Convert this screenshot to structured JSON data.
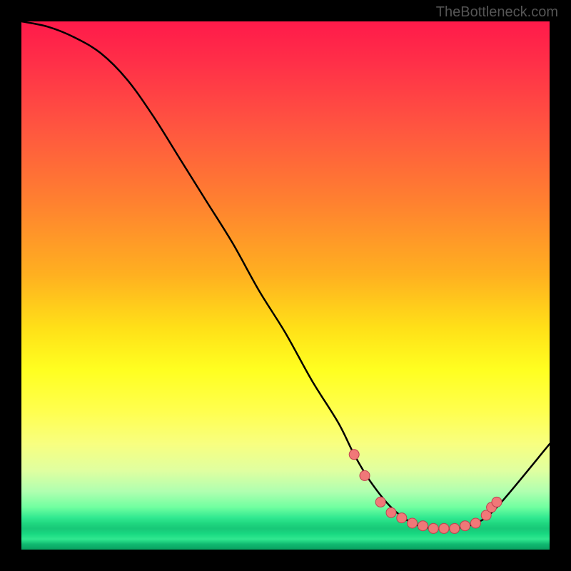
{
  "watermark": "TheBottleneck.com",
  "chart_data": {
    "type": "line",
    "title": "",
    "xlabel": "",
    "ylabel": "",
    "xlim": [
      0,
      100
    ],
    "ylim": [
      0,
      100
    ],
    "series": [
      {
        "name": "curve",
        "x": [
          0,
          5,
          10,
          15,
          20,
          25,
          30,
          35,
          40,
          45,
          50,
          55,
          60,
          63,
          66,
          70,
          74,
          78,
          82,
          86,
          90,
          100
        ],
        "y": [
          100,
          99,
          97,
          94,
          89,
          82,
          74,
          66,
          58,
          49,
          41,
          32,
          24,
          18,
          13,
          8,
          5,
          4,
          4,
          5,
          8,
          20
        ]
      }
    ],
    "markers": [
      {
        "x": 63,
        "y": 18
      },
      {
        "x": 65,
        "y": 14
      },
      {
        "x": 68,
        "y": 9
      },
      {
        "x": 70,
        "y": 7
      },
      {
        "x": 72,
        "y": 6
      },
      {
        "x": 74,
        "y": 5
      },
      {
        "x": 76,
        "y": 4.5
      },
      {
        "x": 78,
        "y": 4
      },
      {
        "x": 80,
        "y": 4
      },
      {
        "x": 82,
        "y": 4
      },
      {
        "x": 84,
        "y": 4.5
      },
      {
        "x": 86,
        "y": 5
      },
      {
        "x": 88,
        "y": 6.5
      },
      {
        "x": 89,
        "y": 8
      },
      {
        "x": 90,
        "y": 9
      }
    ],
    "gradient_stops": [
      {
        "offset": 0,
        "color": "#ff1a4a"
      },
      {
        "offset": 20,
        "color": "#ff5540"
      },
      {
        "offset": 48,
        "color": "#ffb020"
      },
      {
        "offset": 66,
        "color": "#ffff20"
      },
      {
        "offset": 85,
        "color": "#e0ffa0"
      },
      {
        "offset": 94,
        "color": "#30e890"
      },
      {
        "offset": 100,
        "color": "#0aa060"
      }
    ]
  }
}
